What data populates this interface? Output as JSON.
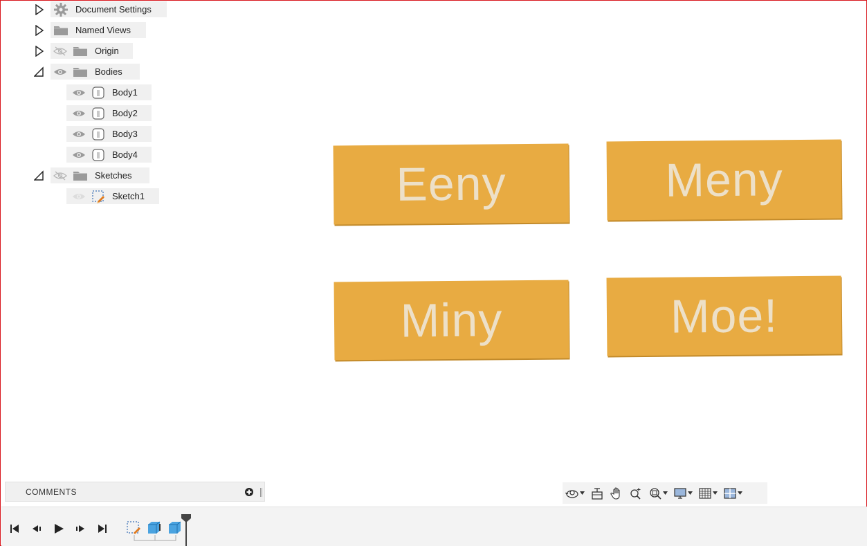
{
  "browser": {
    "items": [
      {
        "label": "Document Settings",
        "icon": "gear-icon"
      },
      {
        "label": "Named Views",
        "icon": "folder-icon"
      },
      {
        "label": "Origin",
        "icon": "folder-icon",
        "visibility": "hidden"
      },
      {
        "label": "Bodies",
        "icon": "folder-icon",
        "visibility": "visible"
      },
      {
        "label": "Body1",
        "icon": "body-icon"
      },
      {
        "label": "Body2",
        "icon": "body-icon"
      },
      {
        "label": "Body3",
        "icon": "body-icon"
      },
      {
        "label": "Body4",
        "icon": "body-icon"
      },
      {
        "label": "Sketches",
        "icon": "folder-icon",
        "visibility": "hidden"
      },
      {
        "label": "Sketch1",
        "icon": "sketch-icon"
      }
    ]
  },
  "canvas": {
    "tiles": [
      "Eeny",
      "Meny",
      "Miny",
      "Moe!"
    ],
    "tile_color": "#e8ab42",
    "text_color": "#ede0c8"
  },
  "comments": {
    "title": "COMMENTS"
  },
  "navbar": {
    "tools": [
      "orbit-icon",
      "look-at-icon",
      "pan-icon",
      "zoom-icon",
      "fit-icon",
      "display-settings-icon",
      "grid-settings-icon",
      "viewports-icon"
    ]
  },
  "timeline": {
    "controls": [
      "go-to-start-icon",
      "step-back-icon",
      "play-icon",
      "step-forward-icon",
      "go-to-end-icon"
    ],
    "features": [
      "sketch-feature-icon",
      "extrude-feature-icon",
      "extrude-feature-icon"
    ]
  },
  "colors": {
    "frame": "#d9161c",
    "panel": "#f0f0f0"
  }
}
